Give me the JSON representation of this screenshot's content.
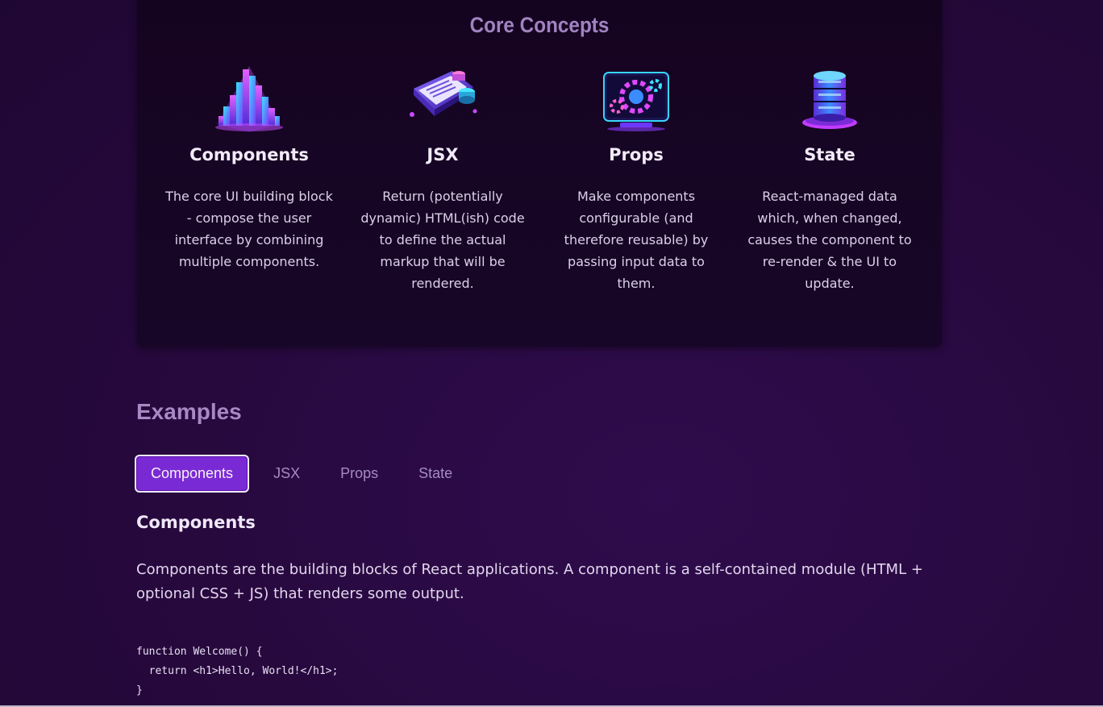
{
  "concepts": {
    "title": "Core Concepts",
    "items": [
      {
        "title": "Components",
        "description": "The core UI building block - compose the user interface by combining multiple components.",
        "icon": "components-icon"
      },
      {
        "title": "JSX",
        "description": "Return (potentially dynamic) HTML(ish) code to define the actual markup that will be rendered.",
        "icon": "jsx-icon"
      },
      {
        "title": "Props",
        "description": "Make components configurable (and therefore reusable) by passing input data to them.",
        "icon": "props-icon"
      },
      {
        "title": "State",
        "description": "React-managed data which, when changed, causes the component to re-render & the UI to update.",
        "icon": "state-icon"
      }
    ]
  },
  "examples": {
    "title": "Examples",
    "tabs": [
      {
        "label": "Components",
        "active": true
      },
      {
        "label": "JSX",
        "active": false
      },
      {
        "label": "Props",
        "active": false
      },
      {
        "label": "State",
        "active": false
      }
    ],
    "active_section": {
      "title": "Components",
      "description": "Components are the building blocks of React applications. A component is a self-contained module (HTML + optional CSS + JS) that renders some output.",
      "code": "function Welcome() {\n  return <h1>Hello, World!</h1>;\n}"
    }
  },
  "colors": {
    "background": "#28093f",
    "card": "#150420",
    "accent": "#7a2ad4",
    "heading": "#a183c0"
  }
}
